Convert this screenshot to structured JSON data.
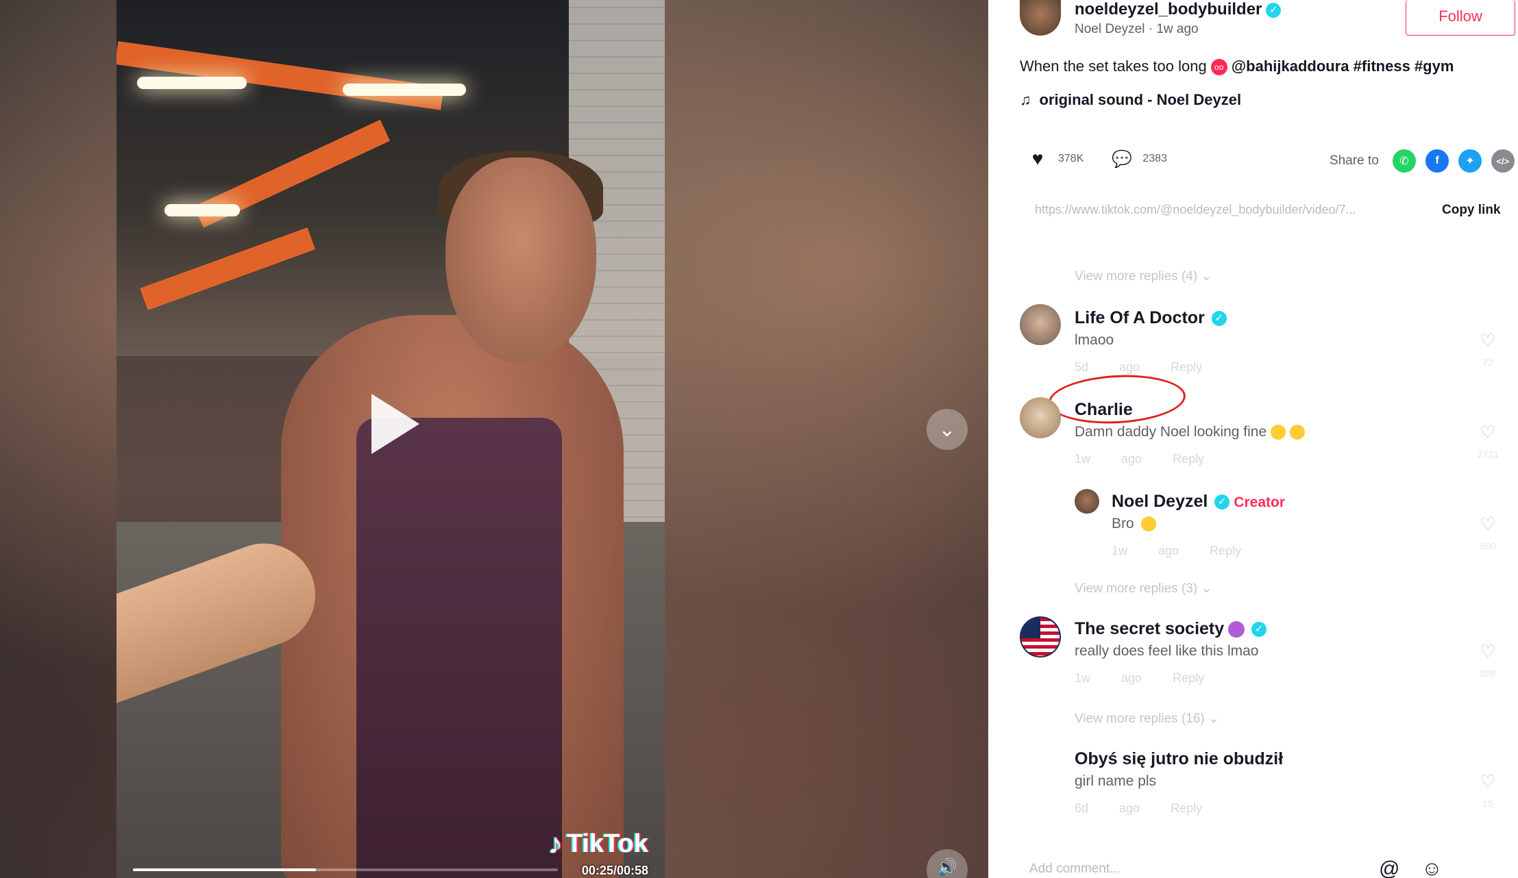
{
  "video": {
    "watermark": "TikTok",
    "time": "00:25/00:58",
    "progress_fraction": 0.43
  },
  "author": {
    "username": "noeldeyzel_bodybuilder",
    "subline": "Noel Deyzel · 1w ago",
    "follow_label": "Follow"
  },
  "caption": {
    "text": "When the set takes too long",
    "mention": "@bahijkaddoura",
    "tags": "#fitness #gym"
  },
  "sound": {
    "label": "original sound - Noel Deyzel"
  },
  "stats": {
    "likes": "378K",
    "comments": "2383"
  },
  "share": {
    "label": "Share to",
    "icons": [
      "whatsapp-icon",
      "facebook-icon",
      "twitter-icon",
      "embed-icon"
    ],
    "colors": {
      "whatsapp": "#25d366",
      "facebook": "#1877f2",
      "twitter": "#1da1f2",
      "embed": "#8a8b91"
    }
  },
  "link": {
    "url": "https://www.tiktok.com/@noeldeyzel_bodybuilder/video/7...",
    "copy_label": "Copy link"
  },
  "comments": {
    "view_more_1": "View more replies (4)",
    "c1": {
      "name": "Life Of A Doctor",
      "text": "lmaoo",
      "date": "5d ago",
      "reply": "Reply",
      "likes": "72"
    },
    "c2": {
      "name": "Charlie",
      "text": "Damn daddy Noel looking fine",
      "date": "1w ago",
      "reply": "Reply",
      "likes": "2721"
    },
    "c2_reply": {
      "name": "Noel Deyzel",
      "badge": "Creator",
      "text": "Bro",
      "date": "1w ago",
      "reply": "Reply",
      "likes": "500"
    },
    "view_more_2": "View more replies (3)",
    "c3": {
      "name": "The secret society",
      "text": "really does feel like this lmao",
      "date": "1w ago",
      "reply": "Reply",
      "likes": "808"
    },
    "view_more_3": "View more replies (16)",
    "c4": {
      "name": "Obyś się jutro nie obudził",
      "text": "girl name pls",
      "date": "6d ago",
      "reply": "Reply",
      "likes": "15"
    }
  },
  "footer": {
    "add_comment_placeholder": "Add comment..."
  },
  "colors": {
    "accent": "#fe2c55",
    "verified": "#20d5ec",
    "annotation": "#e02020"
  }
}
